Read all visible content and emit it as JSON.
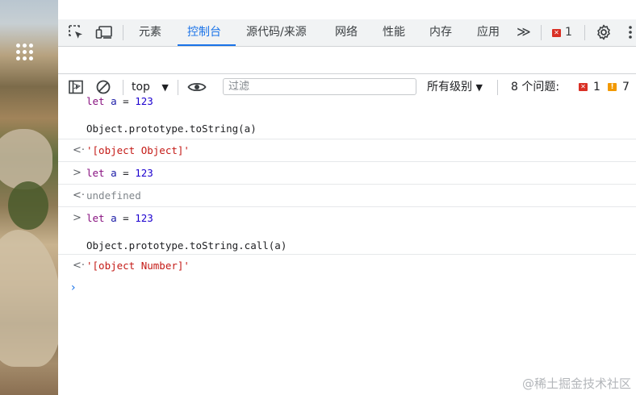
{
  "tabs": [
    "元素",
    "控制台",
    "源代码/来源",
    "网络",
    "性能",
    "内存",
    "应用"
  ],
  "active_tab": "控制台",
  "more_tabs_glyph": "≫",
  "error_count": "1",
  "context": "top",
  "filter_placeholder": "过滤",
  "levels_label": "所有级别",
  "issues_label": "8 个问题:",
  "issues_errors": "1",
  "issues_warnings": "7",
  "console": {
    "entry1_line1": {
      "kw": "let",
      "var": "a",
      "op": " = ",
      "num": "123"
    },
    "entry1_line2": "Object.prototype.toString(a)",
    "result1": "'[object Object]'",
    "entry2": {
      "kw": "let",
      "var": "a",
      "op": " = ",
      "num": "123"
    },
    "result2": "undefined",
    "entry3_line1": {
      "kw": "let",
      "var": "a",
      "op": " = ",
      "num": "123"
    },
    "entry3_line2": "Object.prototype.toString.call(a)",
    "result3": "'[object Number]'"
  },
  "watermark": "@稀土掘金技术社区",
  "colors": {
    "accent": "#1a73e8",
    "error": "#d93025",
    "warning": "#f29900",
    "keyword": "#881280",
    "string": "#c41a16"
  }
}
